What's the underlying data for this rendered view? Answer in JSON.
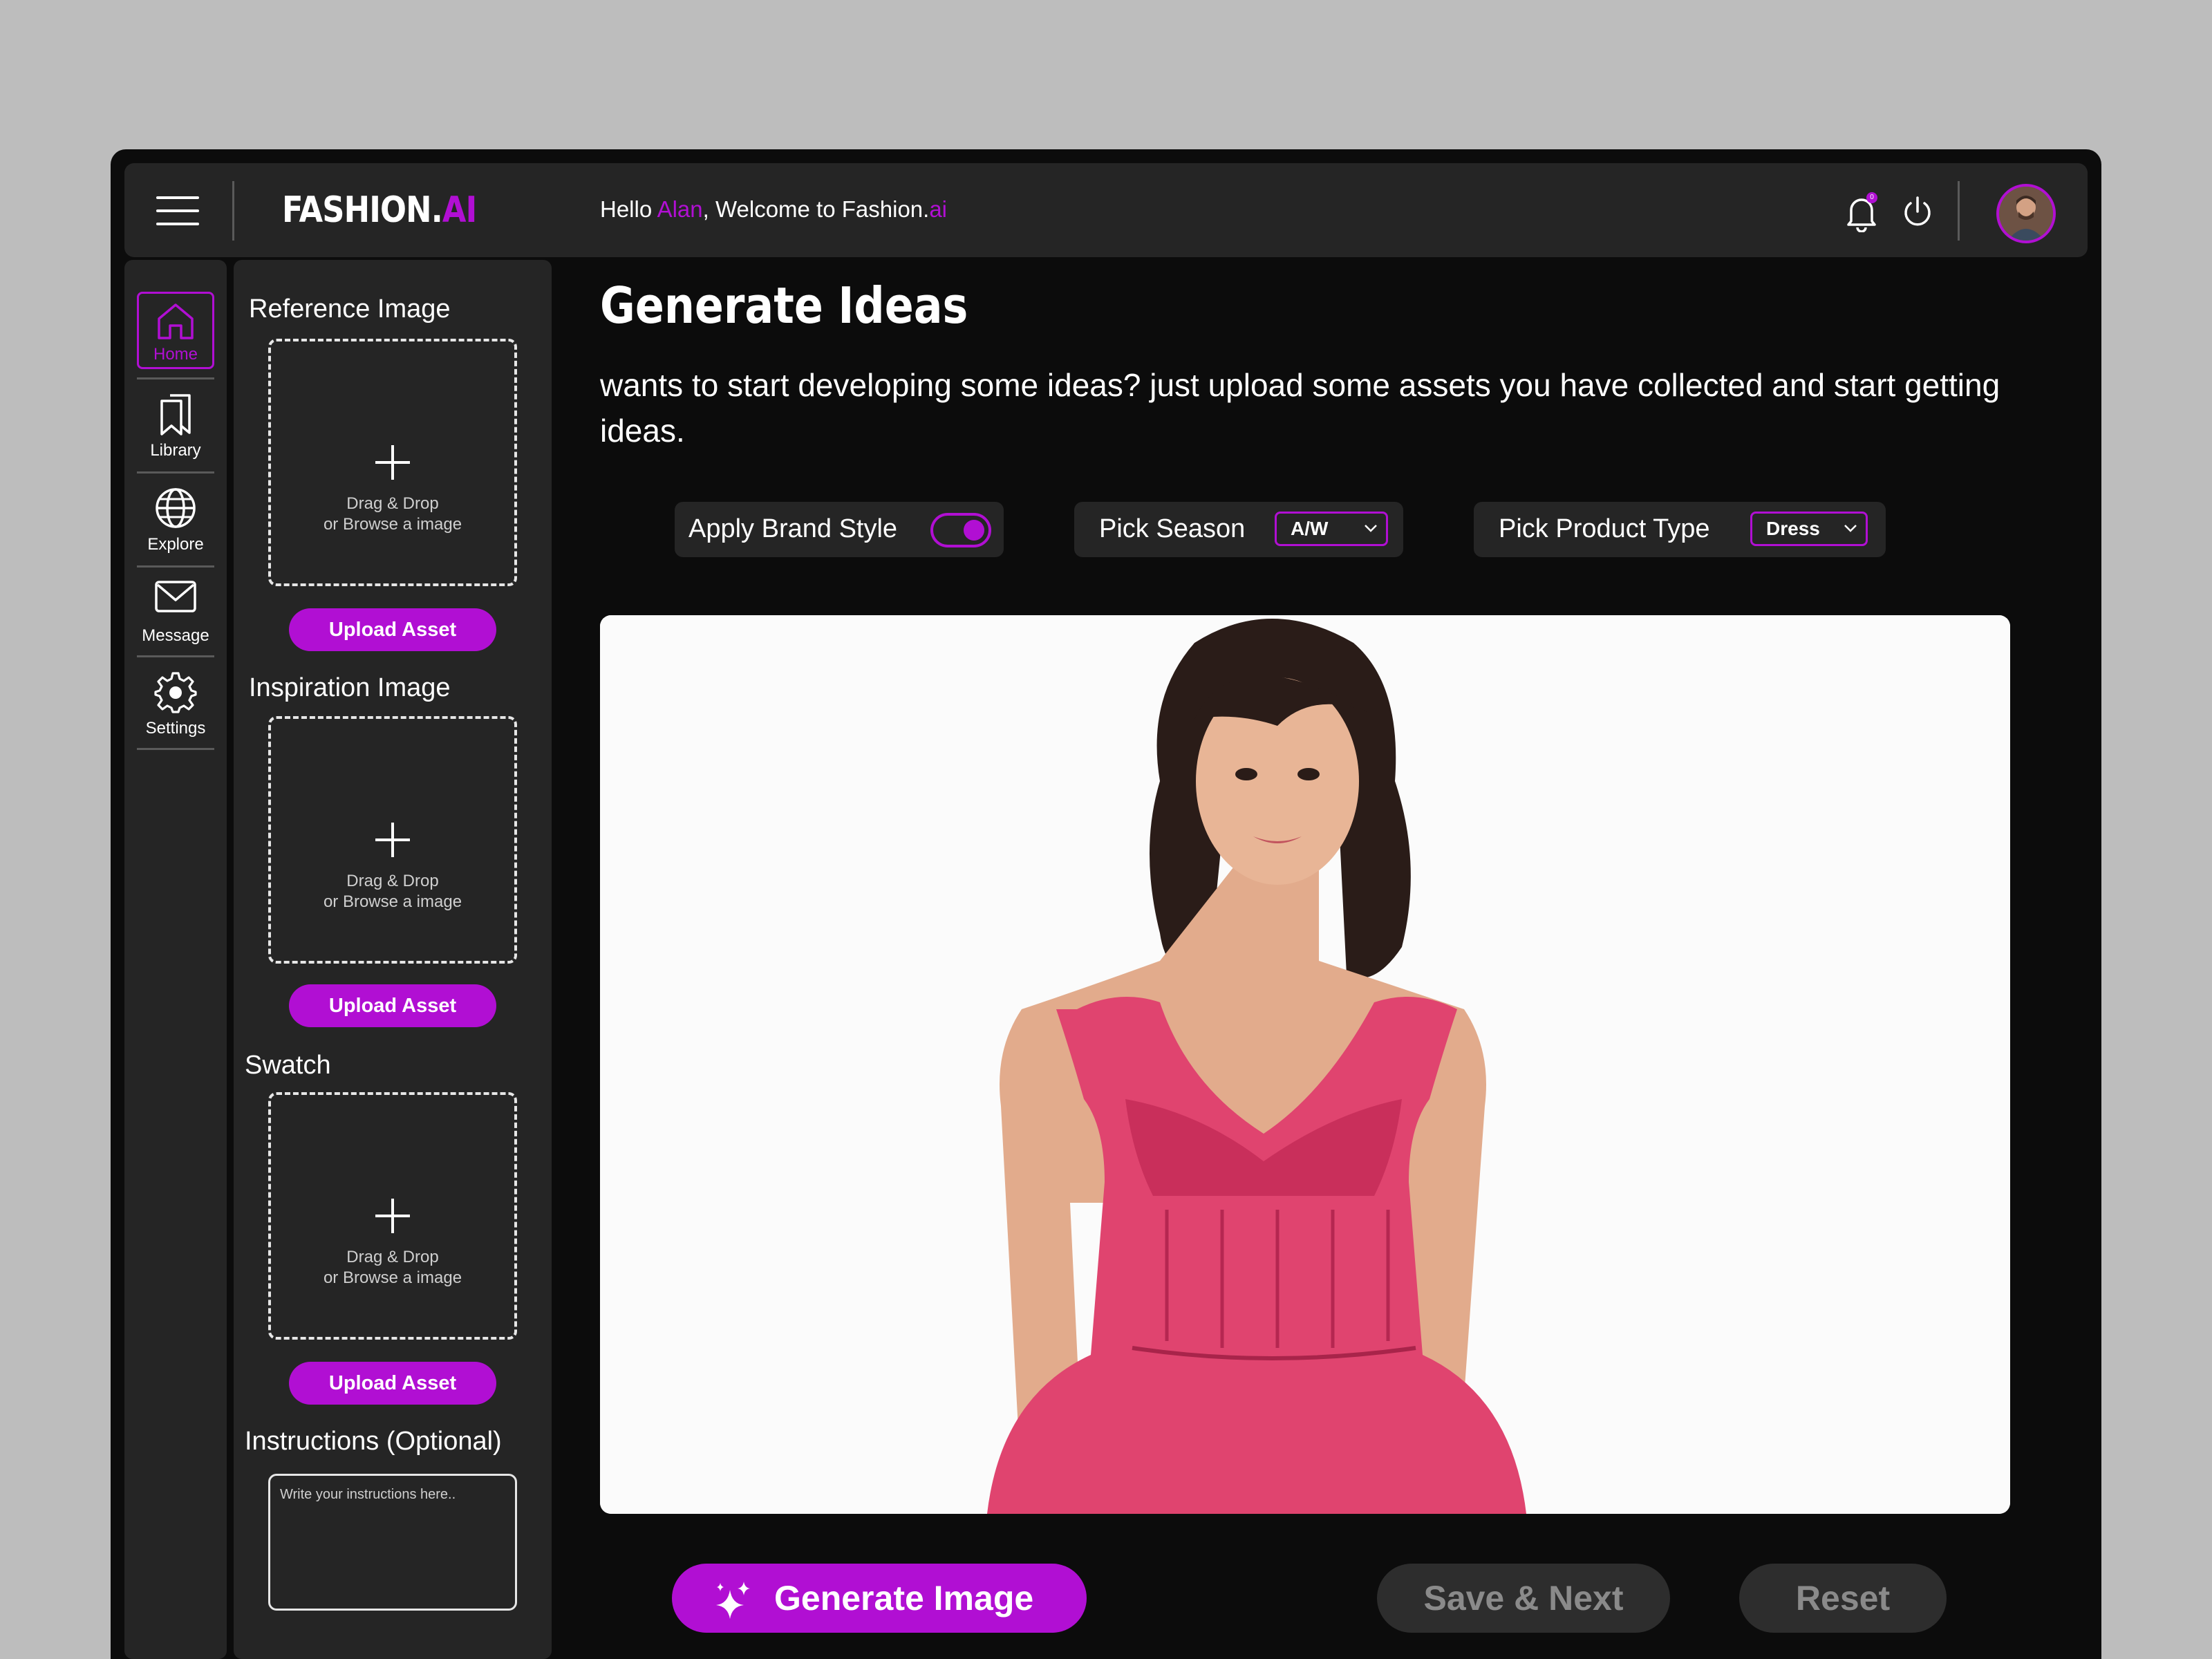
{
  "app": {
    "logo_main": "FASHION.",
    "logo_accent": "AI",
    "greeting_prefix": "Hello ",
    "user_name": "Alan",
    "greeting_mid": ", Welcome to Fashion.",
    "greeting_accent": "ai",
    "notification_count": "0",
    "accent_color": "#b10fd3"
  },
  "nav": {
    "items": [
      {
        "label": "Home",
        "icon": "home-icon",
        "active": true
      },
      {
        "label": "Library",
        "icon": "bookmark-icon",
        "active": false
      },
      {
        "label": "Explore",
        "icon": "globe-icon",
        "active": false
      },
      {
        "label": "Message",
        "icon": "mail-icon",
        "active": false
      },
      {
        "label": "Settings",
        "icon": "gear-icon",
        "active": false
      }
    ]
  },
  "panel": {
    "reference_title": "Reference Image",
    "inspiration_title": "Inspiration Image",
    "swatch_title": "Swatch",
    "dropzone_line1": "Drag & Drop",
    "dropzone_line2": "or Browse a image",
    "upload_label": "Upload Asset",
    "instructions_title": "Instructions (Optional)",
    "instructions_placeholder": "Write your instructions here.."
  },
  "main": {
    "title": "Generate Ideas",
    "subtitle": "wants to start developing some ideas? just upload some assets you have collected and start getting ideas.",
    "apply_brand_label": "Apply Brand Style",
    "apply_brand_on": true,
    "season_label": "Pick Season",
    "season_value": "A/W",
    "product_label": "Pick Product Type",
    "product_value": "Dress"
  },
  "actions": {
    "generate": "Generate Image",
    "save_next": "Save & Next",
    "reset": "Reset"
  }
}
